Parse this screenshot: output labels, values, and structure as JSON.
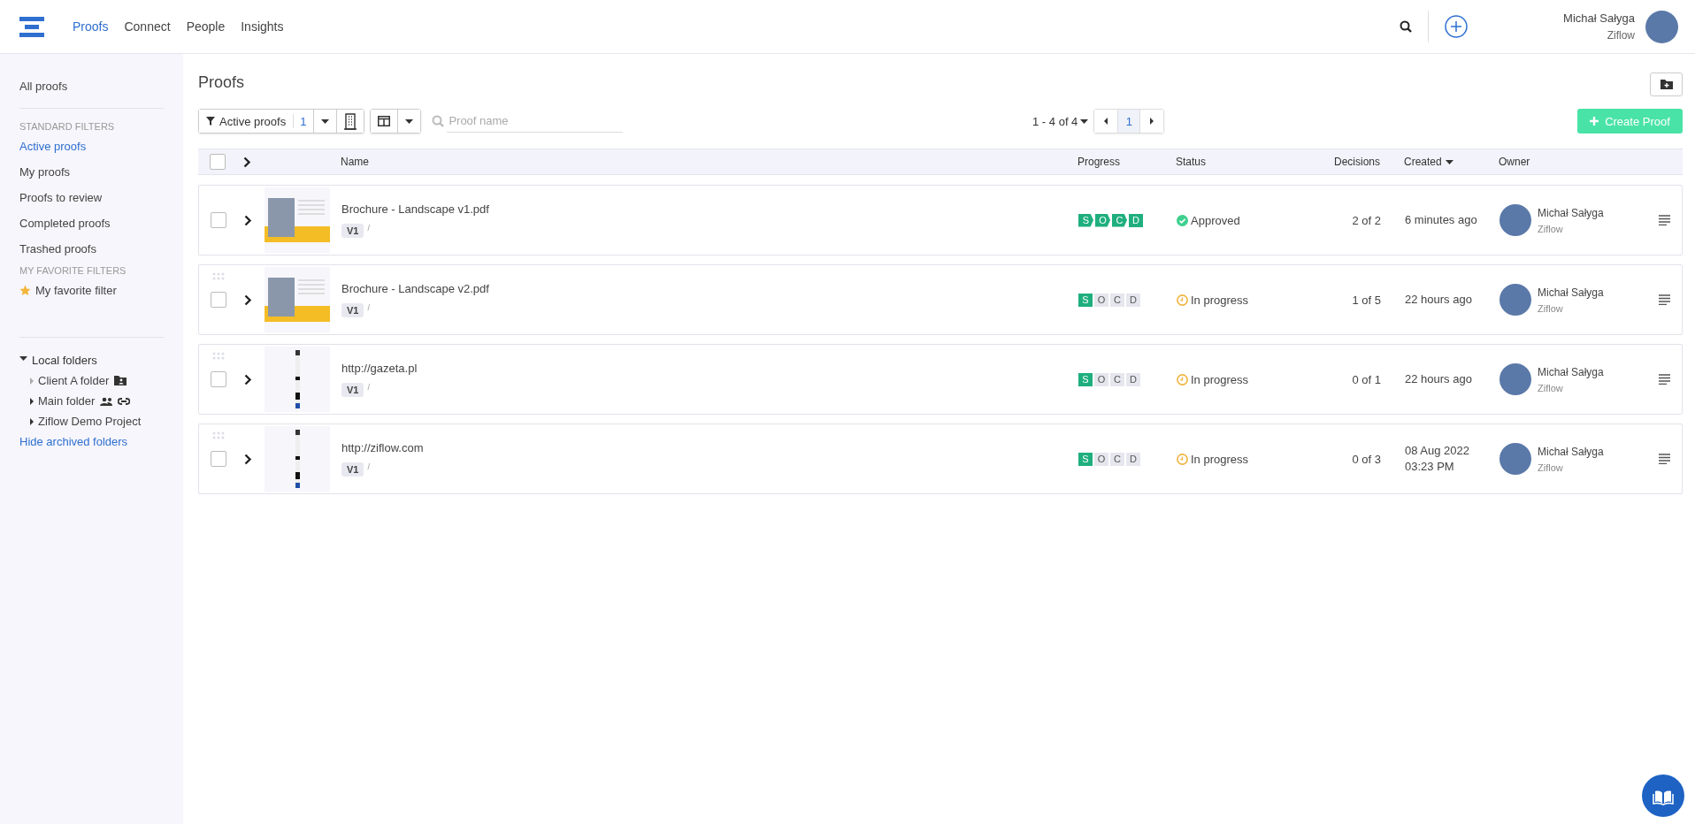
{
  "header": {
    "nav": [
      {
        "label": "Proofs",
        "selected": true
      },
      {
        "label": "Connect",
        "selected": false
      },
      {
        "label": "People",
        "selected": false
      },
      {
        "label": "Insights",
        "selected": false
      }
    ],
    "user": {
      "name": "Michał Sałyga",
      "org": "Ziflow"
    }
  },
  "sidebar": {
    "top_item": {
      "label": "All proofs",
      "selected": false
    },
    "sections": [
      {
        "heading": "STANDARD FILTERS",
        "items": [
          {
            "label": "Active proofs",
            "selected": true,
            "starred": false
          },
          {
            "label": "My proofs",
            "selected": false,
            "starred": false
          },
          {
            "label": "Proofs to review",
            "selected": false,
            "starred": false
          },
          {
            "label": "Completed proofs",
            "selected": false,
            "starred": false
          },
          {
            "label": "Trashed proofs",
            "selected": false,
            "starred": false
          }
        ]
      },
      {
        "heading": "MY FAVORITE FILTERS",
        "items": [
          {
            "label": "My favorite filter",
            "selected": false,
            "starred": true
          }
        ]
      }
    ],
    "folders": {
      "label": "Local folders",
      "expanded": true,
      "children": [
        {
          "label": "Client A folder",
          "expandable": false,
          "kind": "client"
        },
        {
          "label": "Main folder",
          "expandable": true,
          "kind": "shared"
        },
        {
          "label": "Ziflow Demo Project",
          "expandable": true,
          "kind": "plain"
        }
      ]
    },
    "hide_archived": "Hide archived folders"
  },
  "content": {
    "title": "Proofs",
    "filter": {
      "label": "Active proofs",
      "count": "1"
    },
    "search": {
      "placeholder": "Proof name"
    },
    "pagination": {
      "range": "1 - 4 of 4",
      "pages": [
        {
          "label": "1",
          "selected": true
        }
      ]
    },
    "create_button": "Create Proof"
  },
  "table": {
    "all_checked": false,
    "columns": [
      {
        "label": "Name",
        "sorted": false
      },
      {
        "label": "Progress",
        "sorted": false
      },
      {
        "label": "Status",
        "sorted": false
      },
      {
        "label": "Decisions",
        "sorted": false
      },
      {
        "label": "Created",
        "sorted": true
      },
      {
        "label": "Owner",
        "sorted": false
      }
    ],
    "rows": [
      {
        "name": "Brochure - Landscape v1.pdf",
        "version": "V1",
        "path": "/",
        "checked": false,
        "thumbnail": {
          "kind": "brochure"
        },
        "drag_handle": false,
        "stages": [
          {
            "letter": "S",
            "done": true
          },
          {
            "letter": "O",
            "done": true
          },
          {
            "letter": "C",
            "done": true
          },
          {
            "letter": "D",
            "done": true
          }
        ],
        "status": {
          "kind": "approved",
          "label": "Approved"
        },
        "decisions": "2 of 2",
        "created": [
          "6 minutes ago"
        ],
        "owner": {
          "name": "Michał Sałyga",
          "org": "Ziflow"
        }
      },
      {
        "name": "Brochure - Landscape v2.pdf",
        "version": "V1",
        "path": "/",
        "checked": false,
        "thumbnail": {
          "kind": "brochure"
        },
        "drag_handle": true,
        "stages": [
          {
            "letter": "S",
            "done": true
          },
          {
            "letter": "O",
            "done": false
          },
          {
            "letter": "C",
            "done": false
          },
          {
            "letter": "D",
            "done": false
          }
        ],
        "status": {
          "kind": "in_progress",
          "label": "In progress"
        },
        "decisions": "1 of 5",
        "created": [
          "22 hours ago"
        ],
        "owner": {
          "name": "Michał Sałyga",
          "org": "Ziflow"
        }
      },
      {
        "name": "http://gazeta.pl",
        "version": "V1",
        "path": "/",
        "checked": false,
        "thumbnail": {
          "kind": "webpage"
        },
        "drag_handle": true,
        "stages": [
          {
            "letter": "S",
            "done": true
          },
          {
            "letter": "O",
            "done": false
          },
          {
            "letter": "C",
            "done": false
          },
          {
            "letter": "D",
            "done": false
          }
        ],
        "status": {
          "kind": "in_progress",
          "label": "In progress"
        },
        "decisions": "0 of 1",
        "created": [
          "22 hours ago"
        ],
        "owner": {
          "name": "Michał Sałyga",
          "org": "Ziflow"
        }
      },
      {
        "name": "http://ziflow.com",
        "version": "V1",
        "path": "/",
        "checked": false,
        "thumbnail": {
          "kind": "webpage"
        },
        "drag_handle": true,
        "stages": [
          {
            "letter": "S",
            "done": true
          },
          {
            "letter": "O",
            "done": false
          },
          {
            "letter": "C",
            "done": false
          },
          {
            "letter": "D",
            "done": false
          }
        ],
        "status": {
          "kind": "in_progress",
          "label": "In progress"
        },
        "decisions": "0 of 3",
        "created": [
          "08 Aug 2022",
          "03:23 PM"
        ],
        "owner": {
          "name": "Michał Sałyga",
          "org": "Ziflow"
        }
      }
    ]
  }
}
